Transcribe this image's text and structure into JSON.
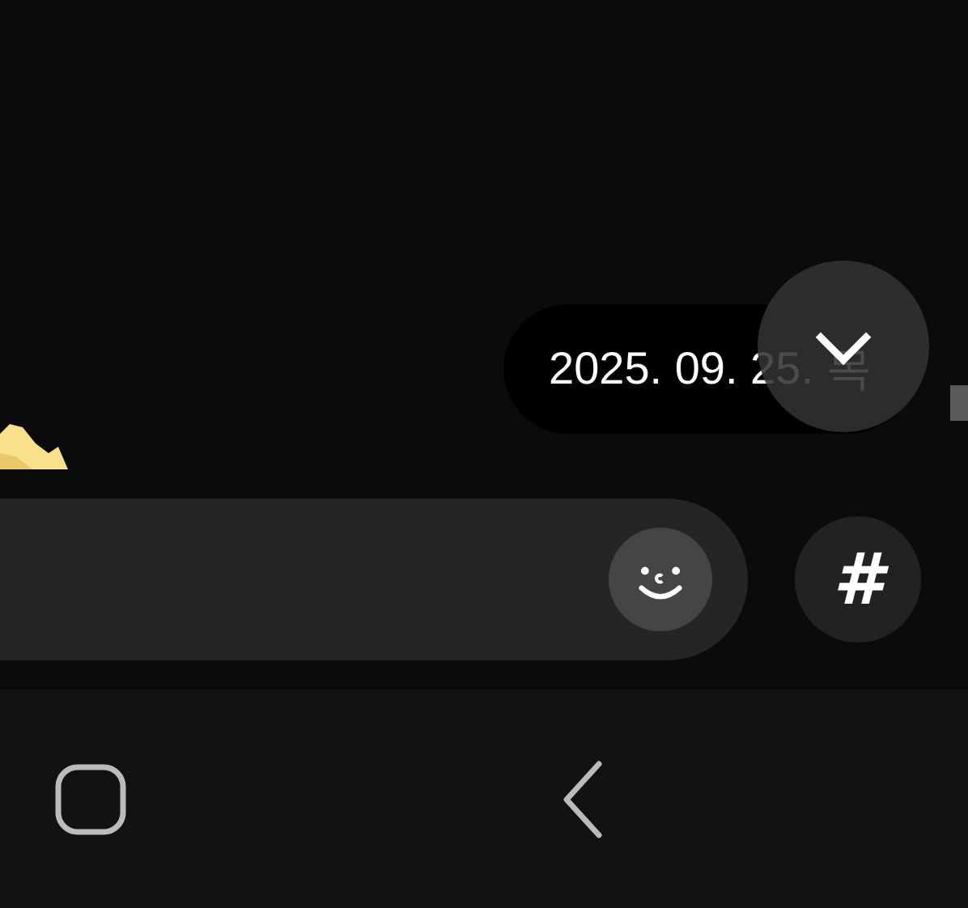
{
  "date_divider": {
    "text": "2025. 09. 25. 목"
  },
  "scroll_down_button": {
    "kind": "chevron"
  },
  "input_bar": {
    "emoji_button": true
  },
  "hashtag_button": {
    "label": "#"
  },
  "nav_bar": {
    "buttons": [
      {
        "kind": "home"
      },
      {
        "kind": "back"
      }
    ]
  }
}
